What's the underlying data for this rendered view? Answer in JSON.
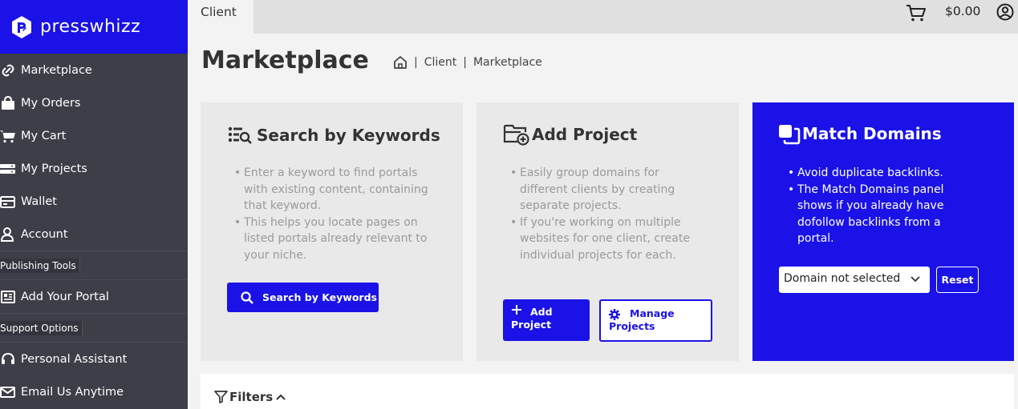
{
  "brand": {
    "name": "presswhizz",
    "logo_icon": "presswhizz-logo-icon",
    "color": "#1a12e6"
  },
  "sidebar": {
    "background": "#3d3e48",
    "items": [
      {
        "label": "Marketplace",
        "icon": "link-icon"
      },
      {
        "label": "My Orders",
        "icon": "shopping-bag-icon"
      },
      {
        "label": "My Cart",
        "icon": "cart-icon"
      },
      {
        "label": "My Projects",
        "icon": "server-icon"
      },
      {
        "label": "Wallet",
        "icon": "wallet-icon"
      },
      {
        "label": "Account",
        "icon": "user-icon"
      }
    ],
    "section_publishing": "Publishing Tools",
    "publishing_items": [
      {
        "label": "Add Your Portal",
        "icon": "newspaper-icon"
      }
    ],
    "section_support": "Support Options",
    "support_items": [
      {
        "label": "Personal Assistant",
        "icon": "headset-icon"
      },
      {
        "label": "Email Us Anytime",
        "icon": "envelope-icon"
      }
    ]
  },
  "topbar": {
    "tab": "Client",
    "cart_total": "$0.00",
    "cart_icon": "cart-icon",
    "user_icon": "user-circle-icon"
  },
  "header": {
    "title": "Marketplace",
    "breadcrumb": {
      "home_icon": "home-icon",
      "items": [
        "Client",
        "Marketplace"
      ],
      "separator": "|"
    }
  },
  "cards": {
    "keywords": {
      "title": "Search by Keywords",
      "icon": "list-search-icon",
      "bullets": [
        "Enter a keyword to find portals with existing content, containing that keyword.",
        "This helps you locate pages on listed portals already relevant to your niche."
      ],
      "button_label": "Search by Keywords",
      "button_icon": "search-icon"
    },
    "project": {
      "title": "Add Project",
      "icon": "folder-plus-icon",
      "bullets": [
        "Easily group domains for different clients by creating separate projects.",
        "If you're working on multiple websites for one client, create individual projects for each."
      ],
      "add_button_label": "Add Project",
      "add_button_icon": "plus-icon",
      "manage_button_label": "Manage Projects",
      "manage_button_icon": "gear-icon"
    },
    "match": {
      "title": "Match Domains",
      "icon": "copy-icon",
      "bullets": [
        "Avoid duplicate backlinks.",
        "The Match Domains panel shows if you already have dofollow backlinks from a portal."
      ],
      "select_value": "Domain not selected",
      "reset_label": "Reset"
    }
  },
  "filters": {
    "label": "Filters",
    "icon": "filter-icon",
    "toggle_icon": "chevron-up-icon"
  }
}
